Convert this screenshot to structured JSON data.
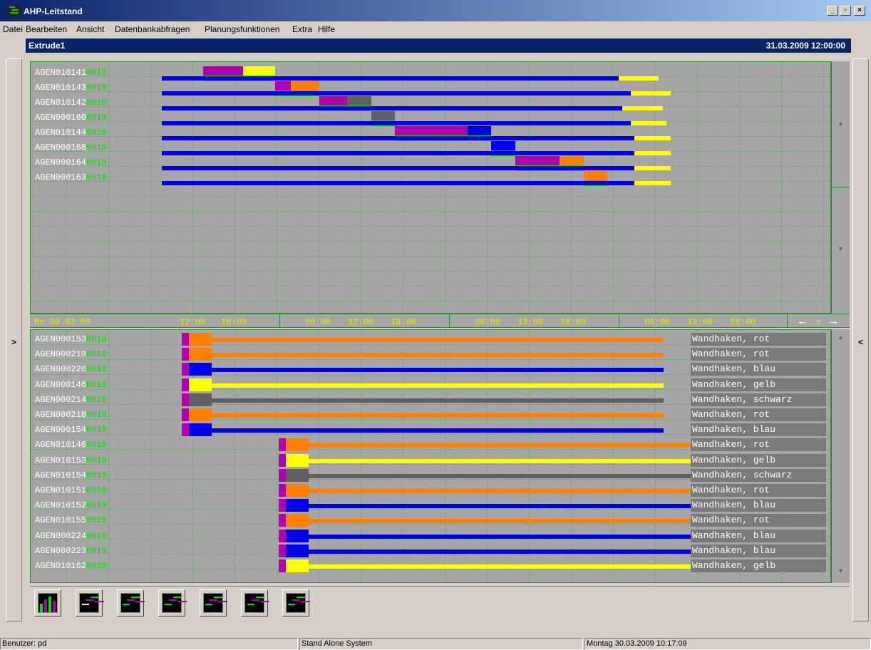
{
  "window": {
    "title": "AHP-Leitstand",
    "buttons": [
      "_",
      "▫",
      "×"
    ]
  },
  "menu": [
    "Datei",
    "Bearbeiten",
    "Ansicht",
    "Datenbankabfragen",
    "Planungsfunktionen",
    "Extra",
    "Hilfe"
  ],
  "document": {
    "title": "Extrude1",
    "datetime": "31.03.2009 12:00:00"
  },
  "side_buttons": {
    "left": ">",
    "right": "<"
  },
  "colors": {
    "magenta": "#b000b0",
    "yellow": "#ffff00",
    "green": "#00e000",
    "blue": "#0000e8",
    "orange": "#ff8000",
    "gray": "#606060",
    "panel_bg": "#a6a6a6"
  },
  "top_panel": {
    "rows": [
      {
        "id": "AGEN010141",
        "suffix": "0010",
        "blue": [
          0.105,
          0.675
        ],
        "yellow": [
          0.675,
          0.725
        ],
        "ops_top": [
          [
            "magenta",
            0.215,
            0.265
          ],
          [
            "yellow",
            0.265,
            0.305
          ]
        ],
        "ops_green": [
          0.215,
          0.305
        ]
      },
      {
        "id": "AGEN010143",
        "suffix": "0010",
        "blue": [
          0.105,
          0.69
        ],
        "yellow": [
          0.69,
          0.74
        ],
        "ops_top": [
          [
            "magenta",
            0.305,
            0.325
          ],
          [
            "orange",
            0.325,
            0.36
          ]
        ],
        "ops_green": [
          0.305,
          0.36
        ]
      },
      {
        "id": "AGEN010142",
        "suffix": "0010",
        "blue": [
          0.105,
          0.68
        ],
        "yellow": [
          0.68,
          0.73
        ],
        "ops_top": [
          [
            "magenta",
            0.36,
            0.395
          ],
          [
            "gray",
            0.395,
            0.425
          ]
        ],
        "ops_green": [
          0.36,
          0.425
        ]
      },
      {
        "id": "AGEN000160",
        "suffix": "0010",
        "blue": [
          0.105,
          0.69
        ],
        "yellow": [
          0.69,
          0.735
        ],
        "ops_top": [
          [
            "gray",
            0.425,
            0.455
          ]
        ],
        "ops_green": [
          0.425,
          0.455
        ]
      },
      {
        "id": "AGEN010144",
        "suffix": "0010",
        "blue": [
          0.105,
          0.695
        ],
        "yellow": [
          0.695,
          0.74
        ],
        "ops_top": [
          [
            "magenta",
            0.455,
            0.545
          ],
          [
            "blue",
            0.545,
            0.575
          ]
        ],
        "ops_green": [
          0.455,
          0.575
        ]
      },
      {
        "id": "AGEN000168",
        "suffix": "0010",
        "blue": [
          0.105,
          0.695
        ],
        "yellow": [
          0.695,
          0.74
        ],
        "ops_top": [
          [
            "blue",
            0.575,
            0.605
          ]
        ],
        "ops_green": [
          0.575,
          0.605
        ]
      },
      {
        "id": "AGEN000164",
        "suffix": "0010",
        "blue": [
          0.105,
          0.695
        ],
        "yellow": [
          0.695,
          0.74
        ],
        "ops_top": [
          [
            "magenta",
            0.605,
            0.66
          ],
          [
            "orange",
            0.66,
            0.69
          ]
        ],
        "ops_green": [
          0.605,
          0.69
        ]
      },
      {
        "id": "AGEN000163",
        "suffix": "0010",
        "blue": [
          0.105,
          0.695
        ],
        "yellow": [
          0.695,
          0.74
        ],
        "ops_top": [
          [
            "orange",
            0.69,
            0.72
          ]
        ],
        "ops_green": [
          0.69,
          0.72
        ]
      }
    ]
  },
  "timeline": {
    "date": "Mo 30.03.09",
    "ticks": [
      "12:00",
      "18:00",
      "06:00",
      "12:00",
      "18:00",
      "06:00",
      "12:00",
      "18:00",
      "06:00",
      "12:00",
      "18:00"
    ]
  },
  "bottom_panel": {
    "rows": [
      {
        "id": "AGEN000153",
        "suffix": "0010",
        "color": "orange",
        "desc": "Wandhaken, rot",
        "start": "early",
        "end": 0.79
      },
      {
        "id": "AGEN000219",
        "suffix": "0010",
        "color": "orange",
        "desc": "Wandhaken, rot",
        "start": "early",
        "end": 0.79
      },
      {
        "id": "AGEN000220",
        "suffix": "0010",
        "color": "blue",
        "desc": "Wandhaken, blau",
        "start": "early",
        "end": 0.79
      },
      {
        "id": "AGEN000146",
        "suffix": "0010",
        "color": "yellow",
        "desc": "Wandhaken, gelb",
        "start": "early",
        "end": 0.79
      },
      {
        "id": "AGEN000214",
        "suffix": "0010",
        "color": "gray",
        "desc": "Wandhaken, schwarz",
        "start": "early",
        "end": 0.79
      },
      {
        "id": "AGEN000218",
        "suffix": "0010",
        "color": "orange",
        "desc": "Wandhaken, rot",
        "start": "early",
        "end": 0.79
      },
      {
        "id": "AGEN000154",
        "suffix": "0010",
        "color": "blue",
        "desc": "Wandhaken, blau",
        "start": "early",
        "end": 0.79
      },
      {
        "id": "AGEN010146",
        "suffix": "0010",
        "color": "orange",
        "desc": "Wandhaken, rot",
        "start": "late",
        "end": 0.9
      },
      {
        "id": "AGEN010153",
        "suffix": "0010",
        "color": "yellow",
        "desc": "Wandhaken, gelb",
        "start": "late",
        "end": 0.9
      },
      {
        "id": "AGEN010154",
        "suffix": "0010",
        "color": "gray",
        "desc": "Wandhaken, schwarz",
        "start": "late",
        "end": 0.9
      },
      {
        "id": "AGEN010151",
        "suffix": "0010",
        "color": "orange",
        "desc": "Wandhaken, rot",
        "start": "late",
        "end": 0.9
      },
      {
        "id": "AGEN010152",
        "suffix": "0010",
        "color": "blue",
        "desc": "Wandhaken, blau",
        "start": "late",
        "end": 0.9
      },
      {
        "id": "AGEN010155",
        "suffix": "0010",
        "color": "orange",
        "desc": "Wandhaken, rot",
        "start": "late",
        "end": 0.9
      },
      {
        "id": "AGEN000224",
        "suffix": "0010",
        "color": "blue",
        "desc": "Wandhaken, blau",
        "start": "late",
        "end": 0.9
      },
      {
        "id": "AGEN000223",
        "suffix": "0010",
        "color": "blue",
        "desc": "Wandhaken, blau",
        "start": "late",
        "end": 0.9
      },
      {
        "id": "AGEN010162",
        "suffix": "0010",
        "color": "yellow",
        "desc": "Wandhaken, gelb",
        "start": "late",
        "end": 0.9
      }
    ]
  },
  "toolbar": {
    "buttons": [
      "chart-bars-icon",
      "chart-yellow-icon",
      "gantt-icon",
      "gantt-multi-icon",
      "table-icon",
      "gantt-list-icon",
      "gantt-detail-icon"
    ]
  },
  "status": {
    "user": "Benutzer: pd",
    "system": "Stand Alone System",
    "datetime": "Montag 30.03.2009 10:17:09"
  }
}
